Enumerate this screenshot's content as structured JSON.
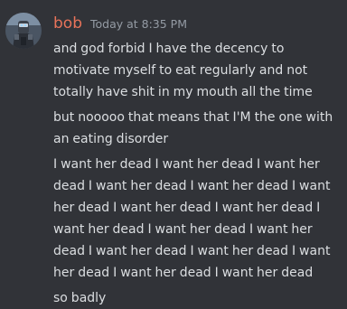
{
  "message_group": {
    "author": "bob",
    "timestamp": "Today at 8:35 PM",
    "avatar_icon": "armored-robot-avatar",
    "colors": {
      "background": "#313338",
      "username": "#e8735a",
      "timestamp": "#949ba4",
      "text": "#dbdee1"
    },
    "messages": [
      "and god forbid I have the decency to motivate myself to eat regularly and not totally have shit in my mouth all the time",
      "but nooooo that means that I'M the one with an eating disorder",
      "I want her dead I want her dead I want her dead I want her dead I want her dead I want her dead I want her dead I want her dead I want her dead I want her dead I want her dead I want her dead I want her dead I want her dead I want her dead I want her dead",
      "so badly"
    ]
  }
}
